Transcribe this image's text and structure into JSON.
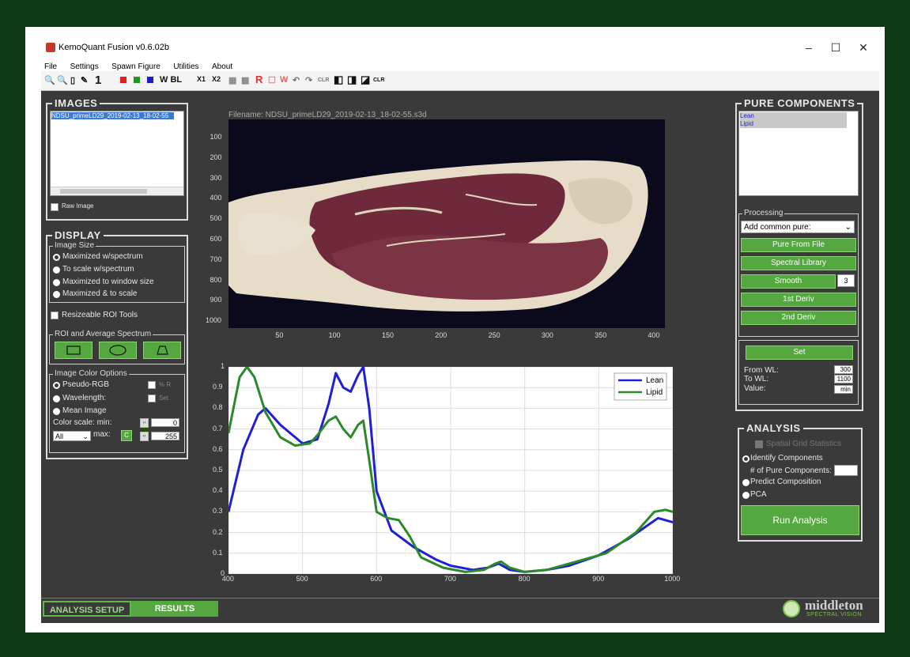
{
  "window": {
    "title": "KemoQuant Fusion v0.6.02b",
    "min": "–",
    "max": "☐",
    "close": "✕"
  },
  "menu": [
    "File",
    "Settings",
    "Spawn Figure",
    "Utilities",
    "About"
  ],
  "toolbar": {
    "one": "1",
    "wbl": "W BL",
    "x1": "X1",
    "x2": "X2",
    "r": "R",
    "w": "W",
    "clr1": "CLR",
    "clr2": "CLR"
  },
  "images": {
    "title": "IMAGES",
    "list": [
      "NDSU_primeLD29_2019-02-13_18-02-55"
    ],
    "raw_image": "Raw Image"
  },
  "display": {
    "title": "DISPLAY",
    "image_size_title": "Image Size",
    "image_size_options": [
      "Maximized w/spectrum",
      "To scale w/spectrum",
      "Maximized to window size",
      "Maximized & to scale"
    ],
    "resizeable": "Resizeable ROI Tools",
    "roi_title": "ROI and Average Spectrum",
    "color_title": "Image Color Options",
    "pseudo_rgb": "Pseudo-RGB",
    "wavelength": "Wavelength:",
    "mean_image": "Mean Image",
    "pct_r": "% R",
    "set": "Set",
    "color_scale": "Color scale: min:",
    "max": "max:",
    "min_value": "0",
    "max_value": "255",
    "all_select": "All",
    "c_button": "C"
  },
  "image_panel": {
    "filename": "Filename: NDSU_primeLD29_2019-02-13_18-02-55.s3d",
    "y_ticks": [
      "100",
      "200",
      "300",
      "400",
      "500",
      "600",
      "700",
      "800",
      "900",
      "1000"
    ],
    "x_ticks": [
      "50",
      "100",
      "150",
      "200",
      "250",
      "300",
      "350",
      "400"
    ]
  },
  "chart_data": {
    "type": "line",
    "xlabel": "",
    "ylabel": "",
    "xlim": [
      400,
      1000
    ],
    "ylim": [
      0,
      1
    ],
    "x_ticks": [
      "400",
      "500",
      "600",
      "700",
      "800",
      "900",
      "1000"
    ],
    "y_ticks": [
      "0",
      "0.1",
      "0.2",
      "0.3",
      "0.4",
      "0.5",
      "0.6",
      "0.7",
      "0.8",
      "0.9",
      "1"
    ],
    "grid": true,
    "legend": "top-right",
    "series": [
      {
        "name": "Lean",
        "color": "#1f1fd6",
        "x": [
          400,
          420,
          440,
          450,
          470,
          500,
          520,
          535,
          545,
          555,
          565,
          575,
          582,
          590,
          600,
          620,
          650,
          680,
          700,
          730,
          750,
          765,
          780,
          800,
          830,
          860,
          900,
          940,
          960,
          980,
          1000
        ],
        "y": [
          0.3,
          0.6,
          0.77,
          0.8,
          0.72,
          0.63,
          0.65,
          0.82,
          0.97,
          0.9,
          0.88,
          0.96,
          1.0,
          0.8,
          0.4,
          0.21,
          0.13,
          0.07,
          0.04,
          0.02,
          0.03,
          0.05,
          0.02,
          0.01,
          0.02,
          0.04,
          0.09,
          0.17,
          0.22,
          0.27,
          0.25
        ]
      },
      {
        "name": "Lipid",
        "color": "#2a8a2a",
        "x": [
          400,
          415,
          425,
          435,
          450,
          470,
          490,
          510,
          520,
          535,
          545,
          555,
          565,
          575,
          582,
          590,
          600,
          615,
          630,
          645,
          660,
          690,
          720,
          745,
          760,
          768,
          780,
          800,
          830,
          870,
          910,
          950,
          975,
          990,
          1000
        ],
        "y": [
          0.68,
          0.95,
          1.0,
          0.95,
          0.78,
          0.66,
          0.62,
          0.63,
          0.67,
          0.74,
          0.76,
          0.7,
          0.66,
          0.72,
          0.74,
          0.55,
          0.3,
          0.27,
          0.26,
          0.18,
          0.08,
          0.03,
          0.01,
          0.02,
          0.05,
          0.06,
          0.03,
          0.01,
          0.02,
          0.06,
          0.1,
          0.2,
          0.3,
          0.31,
          0.3
        ]
      }
    ]
  },
  "pure": {
    "title": "PURE COMPONENTS",
    "list": [
      "Lean",
      "Lipid"
    ],
    "processing_title": "Processing",
    "select": "Add common pure:",
    "pure_from_file": "Pure From File",
    "spectral_library": "Spectral Library",
    "smooth": "Smooth",
    "smooth_value": "3",
    "first_deriv": "1st Deriv",
    "second_deriv": "2nd Deriv",
    "set": "Set",
    "from_wl": "From WL:",
    "from_wl_value": "300",
    "to_wl": "To WL:",
    "to_wl_value": "1100",
    "value": "Value:",
    "value_value": "min"
  },
  "analysis": {
    "title": "ANALYSIS",
    "spatial": "Spatial Grid Statistics",
    "identify": "Identify Components",
    "num_pure": "# of Pure Components:",
    "predict": "Predict Composition",
    "pca": "PCA",
    "run": "Run Analysis"
  },
  "tabs": {
    "setup": "ANALYSIS SETUP",
    "results": "RESULTS"
  },
  "logo": {
    "name": "middleton",
    "sub": "SPECTRAL VISION"
  }
}
